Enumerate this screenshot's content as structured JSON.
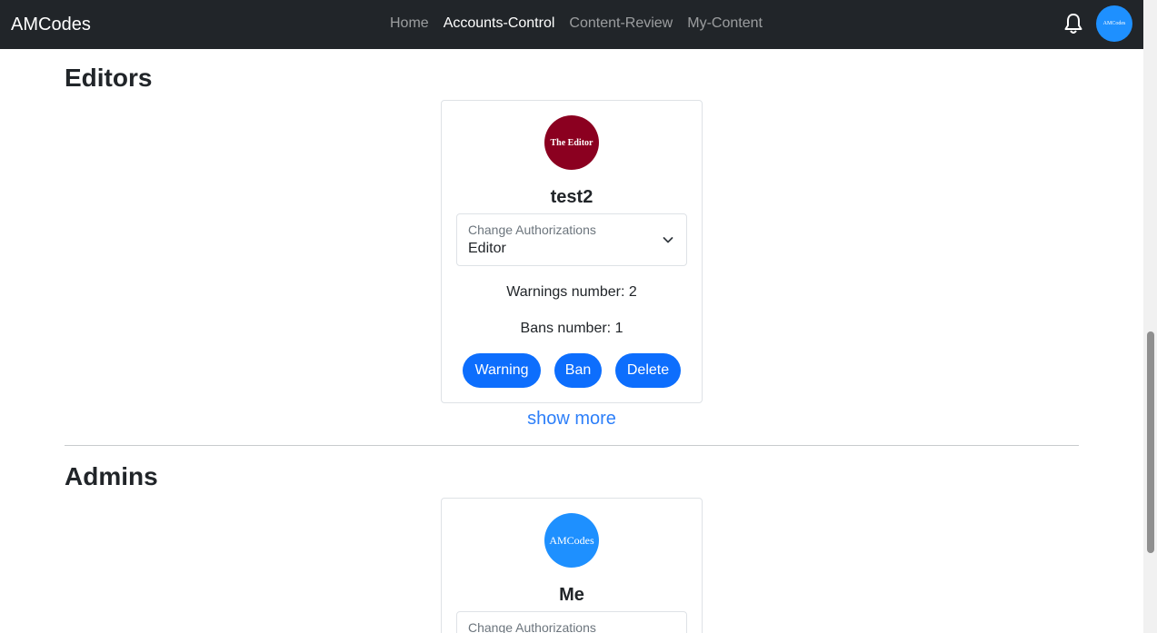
{
  "navbar": {
    "brand": "AMCodes",
    "links": [
      {
        "label": "Home",
        "active": false
      },
      {
        "label": "Accounts-Control",
        "active": true
      },
      {
        "label": "Content-Review",
        "active": false
      },
      {
        "label": "My-Content",
        "active": false
      }
    ],
    "avatar_text": "AMCodes",
    "bell_icon": "bell-icon"
  },
  "editors": {
    "title": "Editors",
    "card": {
      "avatar_text": "The Editor",
      "avatar_color": "#8b0020",
      "name": "test2",
      "select_label": "Change Authorizations",
      "select_value": "Editor",
      "warnings": "Warnings number: 2",
      "bans": "Bans number: 1",
      "buttons": {
        "warning": "Warning",
        "ban": "Ban",
        "delete": "Delete"
      }
    },
    "show_more": "show more"
  },
  "admins": {
    "title": "Admins",
    "card": {
      "avatar_text": "AMCodes",
      "avatar_color": "#1e90ff",
      "name": "Me",
      "select_label": "Change Authorizations"
    }
  },
  "colors": {
    "navbar": "#212529",
    "primary": "#0d6efd",
    "link": "#2d7ff9"
  }
}
